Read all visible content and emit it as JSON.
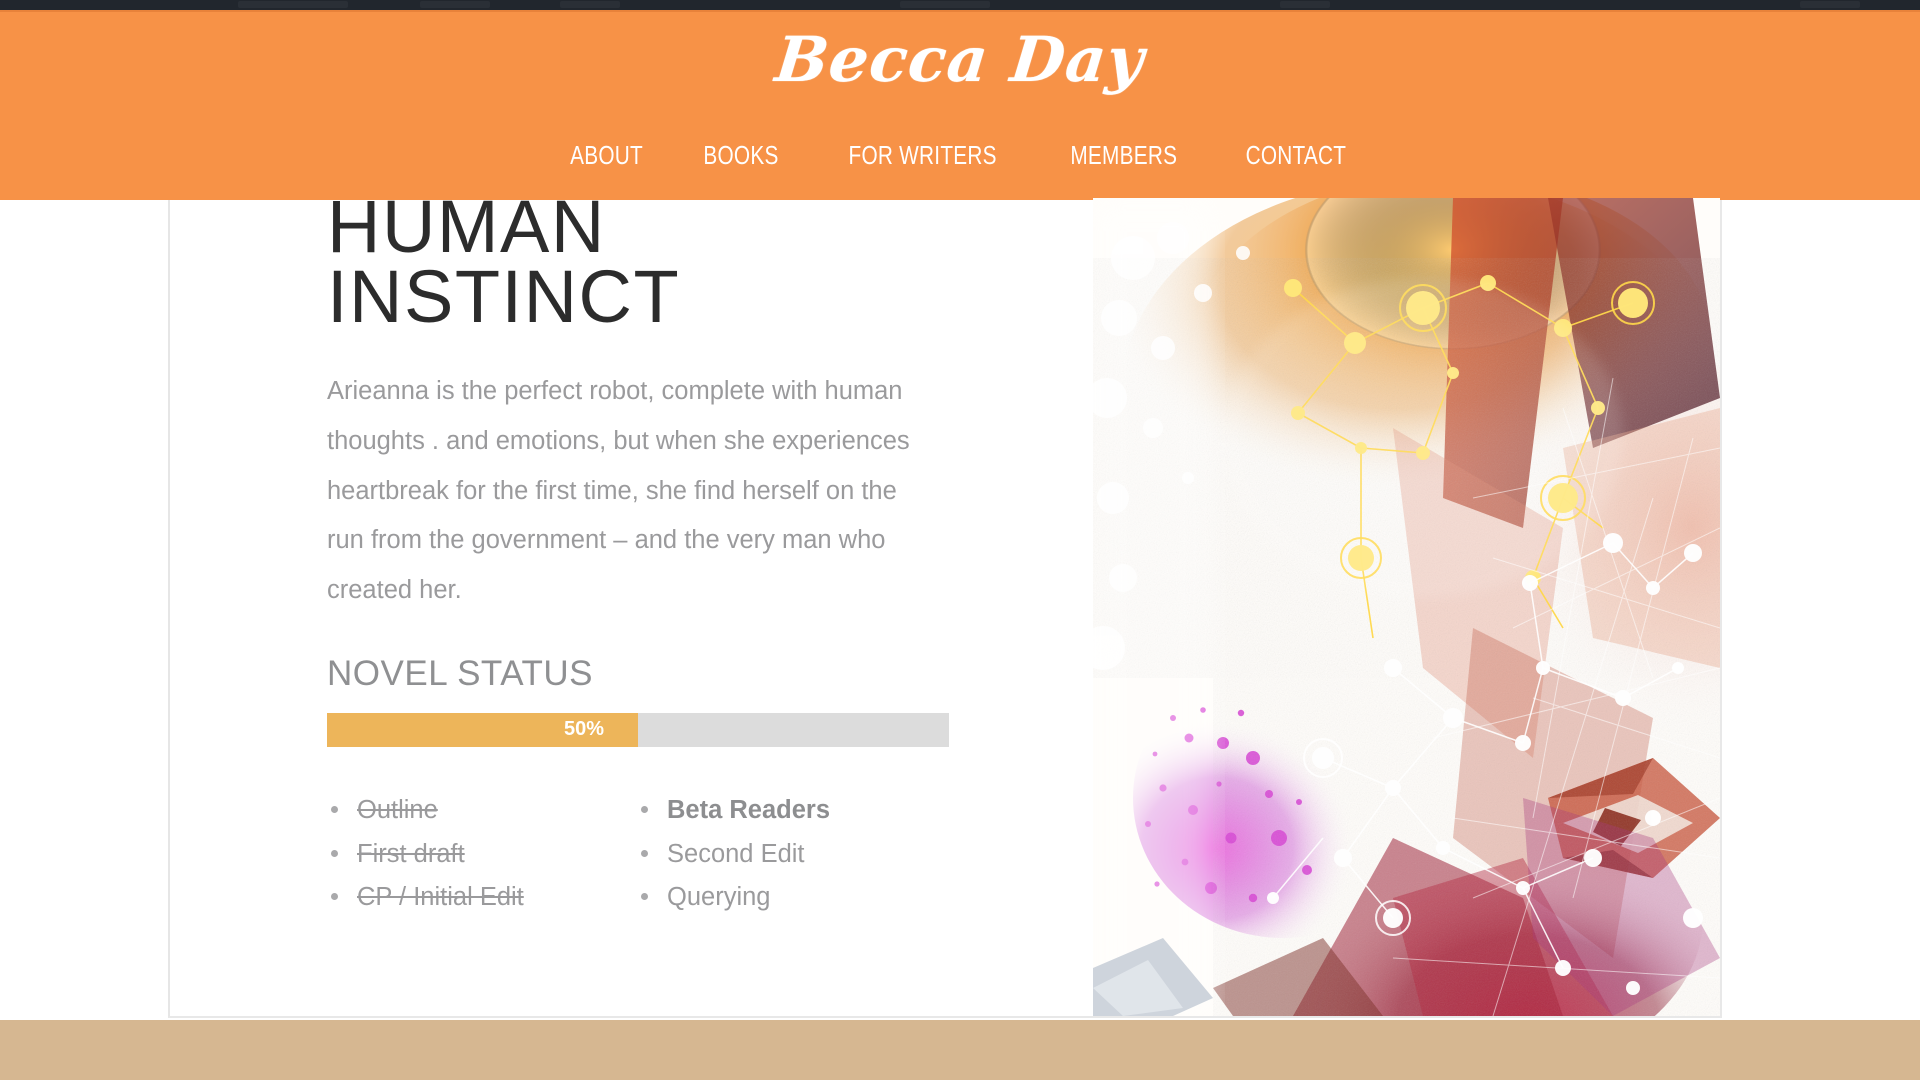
{
  "site": {
    "brand": "Becca Day",
    "brand_color": "#f79247",
    "nav": [
      {
        "label": "ABOUT"
      },
      {
        "label": "BOOKS"
      },
      {
        "label": "FOR WRITERS"
      },
      {
        "label": "MEMBERS"
      },
      {
        "label": "CONTACT"
      }
    ]
  },
  "book": {
    "title": "HUMAN\nINSTINCT",
    "blurb": "Arieanna is the perfect robot, complete with human thoughts . and emotions, but when she experiences heartbreak for the first time, she find herself on the run from the government – and the very man who created her.",
    "cover_alt": "abstract-cover-art"
  },
  "status": {
    "heading": "NOVEL STATUS",
    "percent": 50,
    "percent_label": "50%",
    "fill_color": "#edb55a",
    "track_color": "#dcdcdc",
    "columns": [
      {
        "items": [
          {
            "label": "Outline",
            "state": "done"
          },
          {
            "label": "First draft",
            "state": "done"
          },
          {
            "label": "CP / Initial Edit",
            "state": "done"
          }
        ]
      },
      {
        "items": [
          {
            "label": "Beta Readers",
            "state": "current"
          },
          {
            "label": "Second Edit",
            "state": "pending"
          },
          {
            "label": "Querying",
            "state": "pending"
          }
        ]
      }
    ]
  },
  "footer": {
    "band_color": "#d6b791"
  }
}
